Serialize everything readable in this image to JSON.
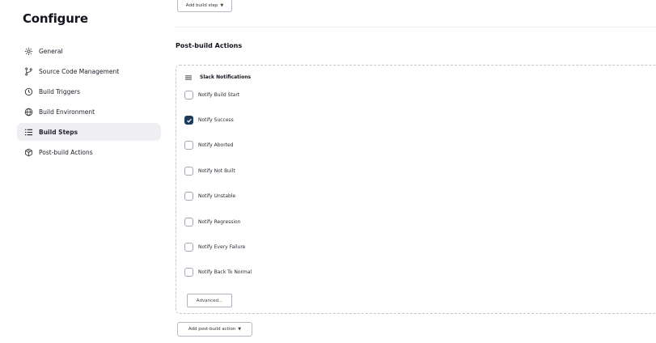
{
  "sidebar": {
    "title": "Configure",
    "items": [
      {
        "label": "General",
        "icon": "gear-icon"
      },
      {
        "label": "Source Code Management",
        "icon": "branch-icon"
      },
      {
        "label": "Build Triggers",
        "icon": "clock-icon"
      },
      {
        "label": "Build Environment",
        "icon": "globe-icon"
      },
      {
        "label": "Build Steps",
        "icon": "list-icon",
        "active": true
      },
      {
        "label": "Post-build Actions",
        "icon": "package-icon"
      }
    ]
  },
  "main": {
    "add_build_step_label": "Add build step",
    "section_title": "Post-build Actions",
    "panel": {
      "title": "Slack Notifications",
      "options": [
        {
          "label": "Notify Build Start",
          "checked": false
        },
        {
          "label": "Notify Success",
          "checked": true
        },
        {
          "label": "Notify Aborted",
          "checked": false
        },
        {
          "label": "Notify Not Built",
          "checked": false
        },
        {
          "label": "Notify Unstable",
          "checked": false
        },
        {
          "label": "Notify Regression",
          "checked": false
        },
        {
          "label": "Notify Every Failure",
          "checked": false
        },
        {
          "label": "Notify Back To Normal",
          "checked": false
        }
      ],
      "advanced_label": "Advanced..."
    },
    "add_post_build_label": "Add post-build action"
  },
  "colors": {
    "accent": "#1e3b5c",
    "active_nav_bg": "#efeff3",
    "text": "#14141f"
  }
}
